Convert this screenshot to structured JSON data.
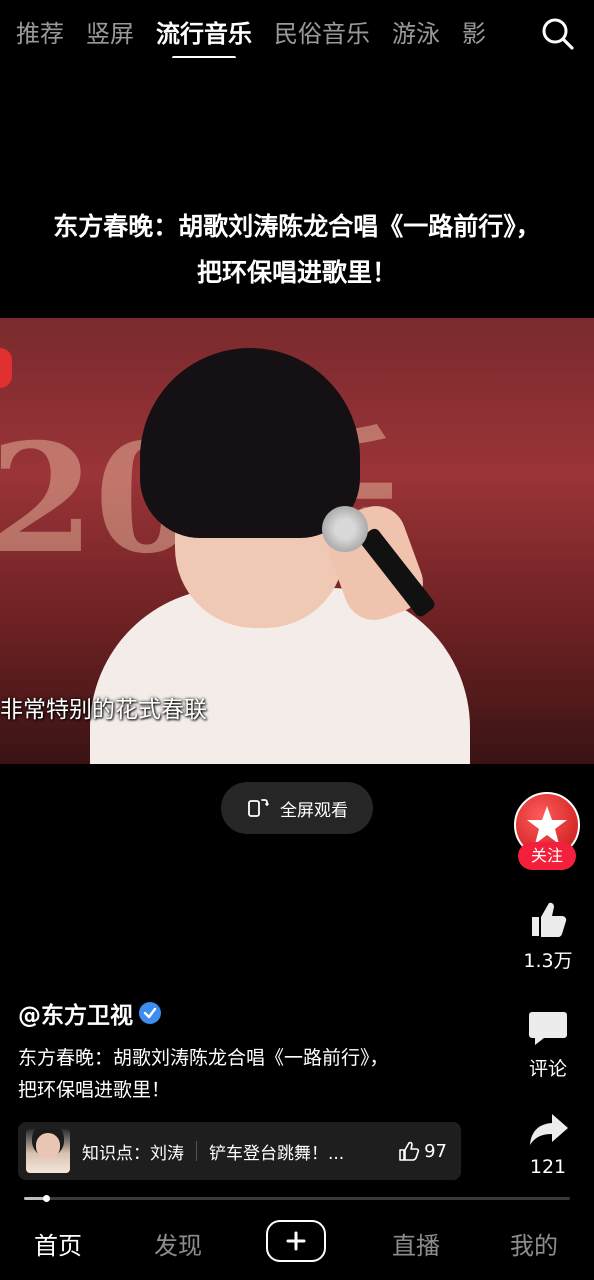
{
  "top_tabs": {
    "items": [
      "推荐",
      "竖屏",
      "流行音乐",
      "民俗音乐",
      "游泳",
      "影"
    ],
    "active_index": 2
  },
  "headline": {
    "line1": "东方春晚：胡歌刘涛陈龙合唱《一路前行》，",
    "line2": "把环保唱进歌里！"
  },
  "video": {
    "background_glyphs": "20 乐",
    "subtitle": "非常特别的花式春联"
  },
  "fullscreen_button": {
    "label": "全屏观看"
  },
  "right_rail": {
    "follow_label": "关注",
    "likes": "1.3万",
    "comments_label": "评论",
    "shares": "121"
  },
  "author": {
    "name": "@东方卫视"
  },
  "caption": {
    "line1": "东方春晚：胡歌刘涛陈龙合唱《一路前行》，",
    "line2": "把环保唱进歌里！"
  },
  "knowledge_bar": {
    "label": "知识点：刘涛",
    "title": "铲车登台跳舞！...",
    "likes": "97"
  },
  "progress": {
    "fraction": 0.04
  },
  "bottom_nav": {
    "home": "首页",
    "discover": "发现",
    "live": "直播",
    "mine": "我的"
  },
  "colors": {
    "background": "#000000",
    "follow_button": "#f2203c",
    "verify_badge": "#3d8cf0"
  }
}
